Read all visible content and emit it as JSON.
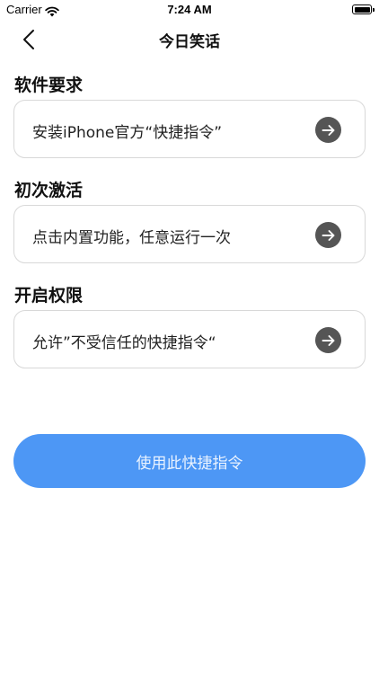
{
  "status_bar": {
    "carrier": "Carrier",
    "time": "7:24 AM"
  },
  "nav": {
    "title": "今日笑话",
    "back_icon": "chevron-left-icon"
  },
  "sections": [
    {
      "title": "软件要求",
      "card_label": "安装iPhone官方“快捷指令”",
      "icon": "arrow-right-circle-icon"
    },
    {
      "title": "初次激活",
      "card_label": "点击内置功能，任意运行一次",
      "icon": "arrow-right-circle-icon"
    },
    {
      "title": "开启权限",
      "card_label": "允许”不受信任的快捷指令“",
      "icon": "arrow-right-circle-icon"
    }
  ],
  "primary_button": {
    "label": "使用此快捷指令"
  },
  "colors": {
    "accent": "#4d97f5",
    "arrow_bg": "#555555",
    "card_border": "#d8d8d8"
  }
}
